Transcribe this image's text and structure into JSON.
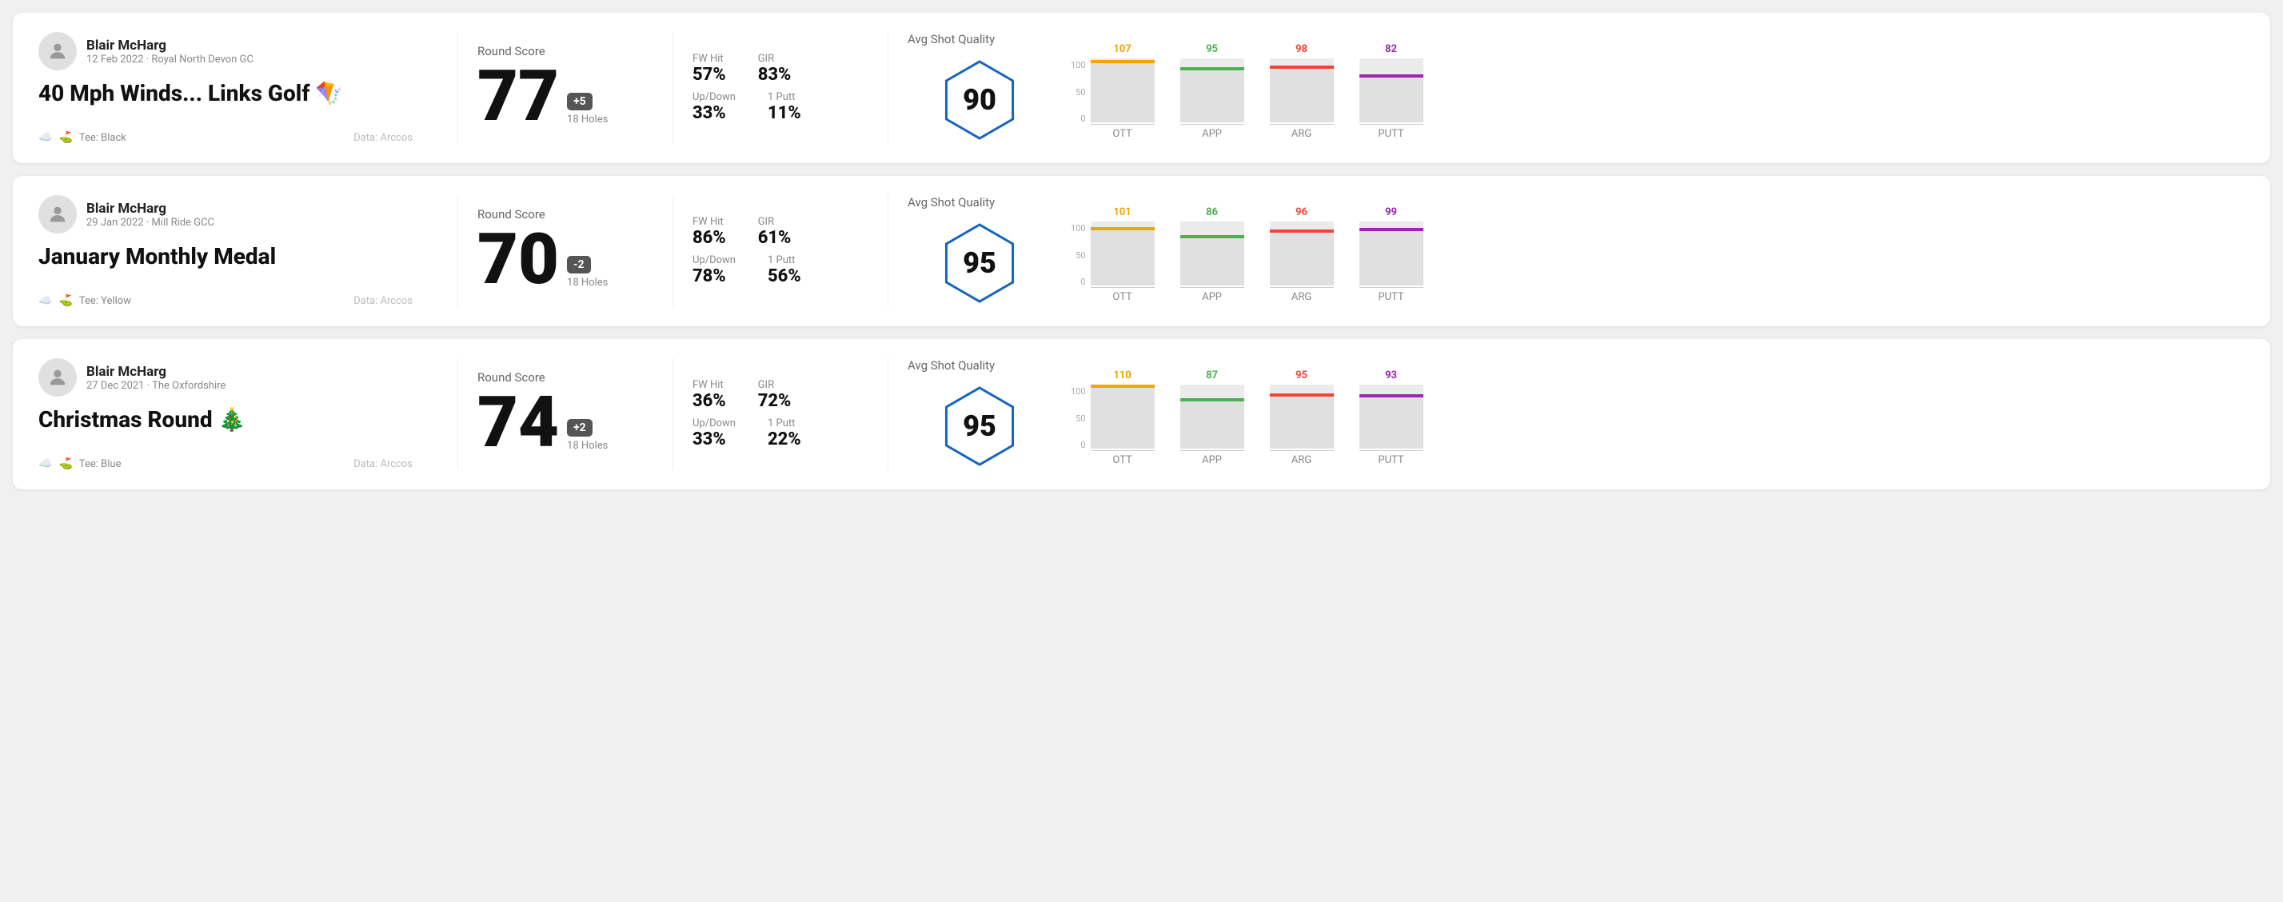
{
  "rounds": [
    {
      "user": {
        "name": "Blair McHarg",
        "meta": "12 Feb 2022 · Royal North Devon GC"
      },
      "title": "40 Mph Winds... Links Golf 🪁",
      "tee": "Tee: Black",
      "data_source": "Data: Arccos",
      "score": {
        "label": "Round Score",
        "number": "77",
        "badge": "+5",
        "badge_type": "positive",
        "holes": "18 Holes"
      },
      "stats": {
        "fw_hit_label": "FW Hit",
        "fw_hit_value": "57%",
        "gir_label": "GIR",
        "gir_value": "83%",
        "updown_label": "Up/Down",
        "updown_value": "33%",
        "oneputt_label": "1 Putt",
        "oneputt_value": "11%"
      },
      "quality": {
        "label": "Avg Shot Quality",
        "score": "90"
      },
      "chart": {
        "bars": [
          {
            "label": "OTT",
            "value": 107,
            "color": "#f0a500",
            "height_pct": 72
          },
          {
            "label": "APP",
            "value": 95,
            "color": "#4caf50",
            "height_pct": 63
          },
          {
            "label": "ARG",
            "value": 98,
            "color": "#f44336",
            "height_pct": 65
          },
          {
            "label": "PUTT",
            "value": 82,
            "color": "#9c27b0",
            "height_pct": 55
          }
        ]
      }
    },
    {
      "user": {
        "name": "Blair McHarg",
        "meta": "29 Jan 2022 · Mill Ride GCC"
      },
      "title": "January Monthly Medal",
      "tee": "Tee: Yellow",
      "data_source": "Data: Arccos",
      "score": {
        "label": "Round Score",
        "number": "70",
        "badge": "-2",
        "badge_type": "negative",
        "holes": "18 Holes"
      },
      "stats": {
        "fw_hit_label": "FW Hit",
        "fw_hit_value": "86%",
        "gir_label": "GIR",
        "gir_value": "61%",
        "updown_label": "Up/Down",
        "updown_value": "78%",
        "oneputt_label": "1 Putt",
        "oneputt_value": "56%"
      },
      "quality": {
        "label": "Avg Shot Quality",
        "score": "95"
      },
      "chart": {
        "bars": [
          {
            "label": "OTT",
            "value": 101,
            "color": "#f0a500",
            "height_pct": 68
          },
          {
            "label": "APP",
            "value": 86,
            "color": "#4caf50",
            "height_pct": 57
          },
          {
            "label": "ARG",
            "value": 96,
            "color": "#f44336",
            "height_pct": 64
          },
          {
            "label": "PUTT",
            "value": 99,
            "color": "#9c27b0",
            "height_pct": 66
          }
        ]
      }
    },
    {
      "user": {
        "name": "Blair McHarg",
        "meta": "27 Dec 2021 · The Oxfordshire"
      },
      "title": "Christmas Round 🎄",
      "tee": "Tee: Blue",
      "data_source": "Data: Arccos",
      "score": {
        "label": "Round Score",
        "number": "74",
        "badge": "+2",
        "badge_type": "positive",
        "holes": "18 Holes"
      },
      "stats": {
        "fw_hit_label": "FW Hit",
        "fw_hit_value": "36%",
        "gir_label": "GIR",
        "gir_value": "72%",
        "updown_label": "Up/Down",
        "updown_value": "33%",
        "oneputt_label": "1 Putt",
        "oneputt_value": "22%"
      },
      "quality": {
        "label": "Avg Shot Quality",
        "score": "95"
      },
      "chart": {
        "bars": [
          {
            "label": "OTT",
            "value": 110,
            "color": "#f0a500",
            "height_pct": 73
          },
          {
            "label": "APP",
            "value": 87,
            "color": "#4caf50",
            "height_pct": 58
          },
          {
            "label": "ARG",
            "value": 95,
            "color": "#f44336",
            "height_pct": 63
          },
          {
            "label": "PUTT",
            "value": 93,
            "color": "#9c27b0",
            "height_pct": 62
          }
        ]
      }
    }
  ]
}
